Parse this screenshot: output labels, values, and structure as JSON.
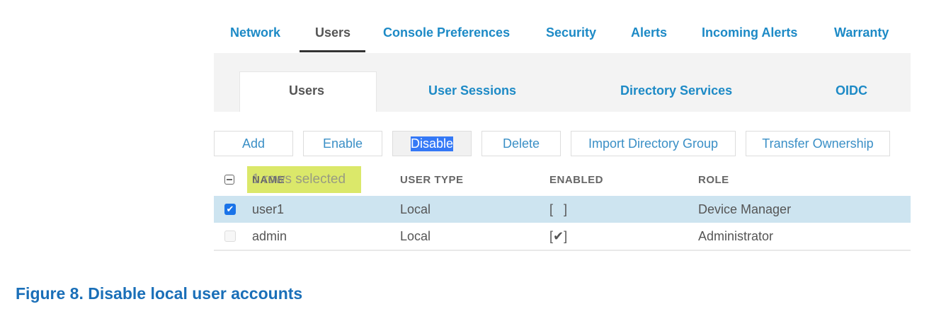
{
  "top_tabs": [
    "Network",
    "Users",
    "Console Preferences",
    "Security",
    "Alerts",
    "Incoming Alerts",
    "Warranty"
  ],
  "sub_tabs": [
    "Users",
    "User Sessions",
    "Directory Services",
    "OIDC"
  ],
  "buttons": [
    "Add",
    "Enable",
    "Disable",
    "Delete",
    "Import Directory Group",
    "Transfer Ownership"
  ],
  "table": {
    "headers": [
      "NAME",
      "USER TYPE",
      "ENABLED",
      "ROLE"
    ],
    "selection_text": "1 rows selected",
    "rows": [
      {
        "name": "user1",
        "type": "Local",
        "enabled": "[   ]",
        "role": "Device Manager",
        "selected": true
      },
      {
        "name": "admin",
        "type": "Local",
        "enabled": "[✔]",
        "role": "Administrator",
        "selected": false
      }
    ]
  },
  "caption": "Figure 8. Disable local user accounts",
  "colors": {
    "link": "#1d8ac6",
    "highlight": "#cde4f0",
    "caption": "#1a6fb8"
  }
}
